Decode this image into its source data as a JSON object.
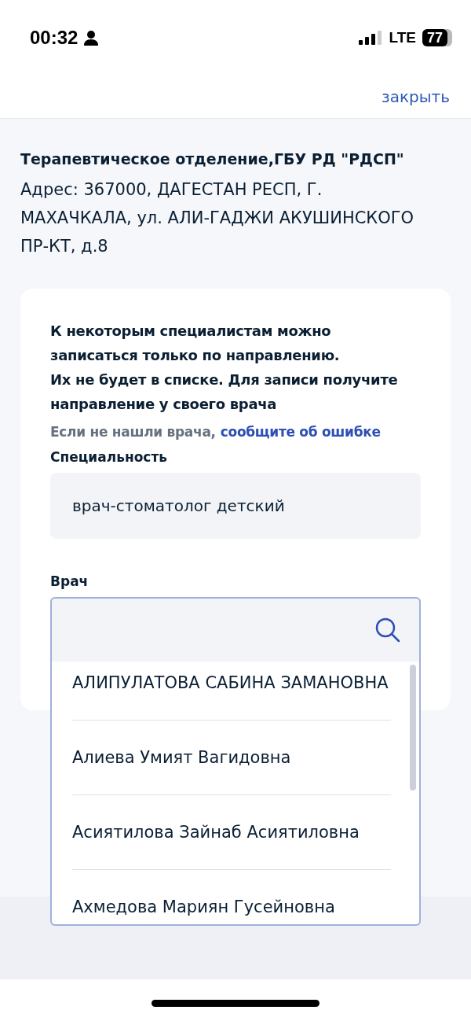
{
  "status_bar": {
    "time": "00:32",
    "network": "LTE",
    "battery": "77"
  },
  "header": {
    "close_link": "закрыть"
  },
  "clinic": {
    "name": "Терапевтическое отделение,ГБУ РД \"РДСП\"",
    "address": "Адрес: 367000, ДАГЕСТАН РЕСП, Г. МАХАЧКАЛА, ул. АЛИ-ГАДЖИ АКУШИНСКОГО ПР-КТ, д.8"
  },
  "card": {
    "notice": "К некоторым специалистам можно записаться только по направлению.\nИх не будет в списке. Для записи получите направление у своего врача",
    "hint": "Если не нашли врача,",
    "hint_link": "сообщите об ошибке",
    "specialty_label": "Специальность",
    "specialty_value": "врач-стоматолог детский",
    "doctor_label": "Врач"
  },
  "doctor_list": [
    {
      "name": "АЛИПУЛАТОВА САБИНА ЗАМАНОВНА"
    },
    {
      "name": "Алиева Умият Вагидовна"
    },
    {
      "name": "Асиятилова Зайнаб Асиятиловна"
    },
    {
      "name": "Ахмедова Мариян Гусейновна"
    }
  ]
}
